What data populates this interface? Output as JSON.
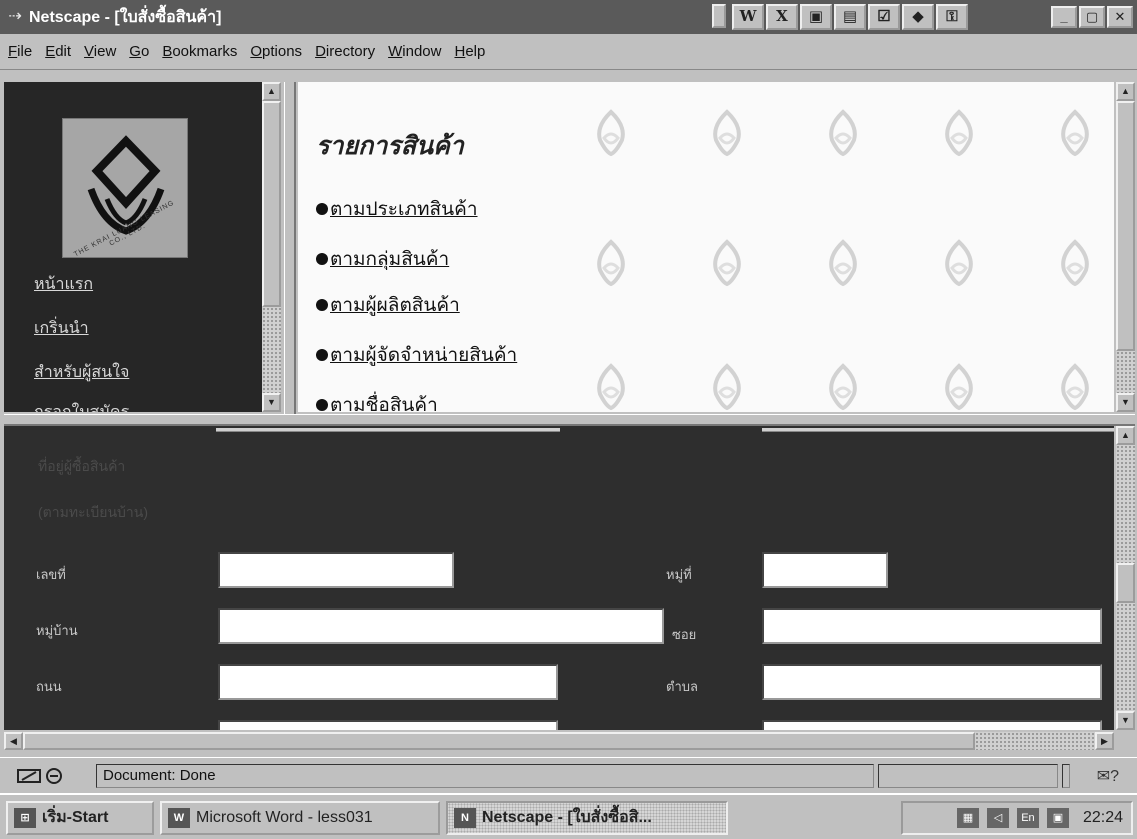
{
  "window": {
    "title": "Netscape - [ใบสั่งซื้อสินค้า]",
    "app_icon": "netscape-icon",
    "min_glyph": "_",
    "max_glyph": "▢",
    "close_glyph": "✕"
  },
  "title_tools": [
    {
      "icon": "word-icon",
      "glyph": "W"
    },
    {
      "icon": "excel-icon",
      "glyph": "X"
    },
    {
      "icon": "powerpoint-icon",
      "glyph": "▣"
    },
    {
      "icon": "project-icon",
      "glyph": "▤"
    },
    {
      "icon": "schedule-icon",
      "glyph": "☑"
    },
    {
      "icon": "bookshelf-icon",
      "glyph": "◆"
    },
    {
      "icon": "key-icon",
      "glyph": "⚿"
    }
  ],
  "menu": [
    {
      "mnemonic": "F",
      "rest": "ile"
    },
    {
      "mnemonic": "E",
      "rest": "dit"
    },
    {
      "mnemonic": "V",
      "rest": "iew"
    },
    {
      "mnemonic": "G",
      "rest": "o"
    },
    {
      "mnemonic": "B",
      "rest": "ookmarks"
    },
    {
      "mnemonic": "O",
      "rest": "ptions"
    },
    {
      "mnemonic": "D",
      "rest": "irectory"
    },
    {
      "mnemonic": "W",
      "rest": "indow"
    },
    {
      "mnemonic": "H",
      "rest": "elp"
    }
  ],
  "sidebar": {
    "logo_text": "THE KRAI LUANG LEASING CO., LTD.",
    "links": [
      "หน้าแรก",
      "เกริ่นนำ",
      "สำหรับผู้สนใจ",
      "กรอกใบสมัคร"
    ]
  },
  "main": {
    "heading": "รายการสินค้า",
    "links": [
      "ตามประเภทสินค้า",
      "ตามกลุ่มสินค้า",
      "ตามผู้ผลิตสินค้า",
      "ตามผู้จัดจำหน่ายสินค้า",
      "ตามชื่อสินค้า"
    ]
  },
  "form": {
    "faint_heading": "ที่อยู่ผู้ซื้อสินค้า",
    "faint_subheading": "(ตามทะเบียนบ้าน)",
    "labels": {
      "house_no": "เลขที่",
      "moo": "หมู่ที่",
      "village": "หมู่บ้าน",
      "soi": "ซอย",
      "road": "ถนน",
      "tambon": "ตำบล"
    },
    "values": {
      "house_no": "",
      "moo": "",
      "village": "",
      "soi": "",
      "road": "",
      "tambon": ""
    }
  },
  "status": {
    "text": "Document: Done",
    "security_icon": "security-key-icon",
    "mail_icon": "mail-icon"
  },
  "taskbar": {
    "start": "เริ่ม-Start",
    "tasks": [
      {
        "label": "Microsoft Word - less031",
        "active": false
      },
      {
        "label": "Netscape - [ใบสั่งซื้อสิ...",
        "active": true
      }
    ],
    "tray_lang": "En",
    "clock": "22:24"
  }
}
